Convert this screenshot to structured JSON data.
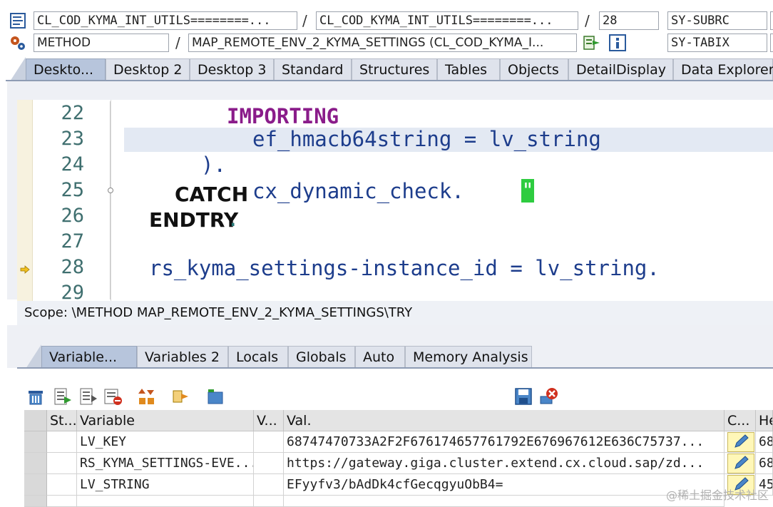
{
  "header": {
    "program": "CL_COD_KYMA_INT_UTILS========...",
    "include": "CL_COD_KYMA_INT_UTILS========...",
    "line": "28",
    "type": "METHOD",
    "method": "MAP_REMOTE_ENV_2_KYMA_SETTINGS (CL_COD_KYMA_I...",
    "sys_field_1": "SY-SUBRC",
    "sys_field_2": "SY-TABIX",
    "separator": "/"
  },
  "top_tabs": [
    "Deskto...",
    "Desktop 2",
    "Desktop 3",
    "Standard",
    "Structures",
    "Tables",
    "Objects",
    "DetailDisplay",
    "Data Explorer"
  ],
  "editor": {
    "lines": [
      {
        "num": "22",
        "kw": "IMPORTING"
      },
      {
        "num": "23",
        "text": "ef_hmacb64string = lv_string"
      },
      {
        "num": "24",
        "text": ")."
      },
      {
        "num": "25",
        "kw": "CATCH",
        "text": "cx_dynamic_check.",
        "comment": "\""
      },
      {
        "num": "26",
        "kw": "ENDTRY",
        "text": "."
      },
      {
        "num": "27"
      },
      {
        "num": "28",
        "text": "rs_kyma_settings-instance_id = lv_string."
      },
      {
        "num": "29"
      }
    ]
  },
  "scope": "Scope: \\METHOD MAP_REMOTE_ENV_2_KYMA_SETTINGS\\TRY",
  "bottom_tabs": [
    "Variable...",
    "Variables 2",
    "Locals",
    "Globals",
    "Auto",
    "Memory Analysis"
  ],
  "grid": {
    "headers": [
      "St...",
      "Variable",
      "V...",
      "Val.",
      "C...",
      "He"
    ],
    "rows": [
      {
        "variable": "LV_KEY",
        "value": "68747470733A2F2F676174657761792E676967612E636C75737...",
        "hex": "68"
      },
      {
        "variable": "RS_KYMA_SETTINGS-EVE...",
        "value": "https://gateway.giga.cluster.extend.cx.cloud.sap/zd...",
        "hex": "68"
      },
      {
        "variable": "LV_STRING",
        "value": "EFyyfv3/bAdDk4cfGecqgyuObB4=",
        "hex": "45"
      }
    ]
  },
  "watermark": "@稀土掘金技术社区",
  "colors": {
    "keyword": "#8a1c8a",
    "identifier": "#1d3d8c",
    "line_number": "#3f6f6f",
    "active_tab": "#b7c5dc",
    "comment_marker": "#2ecc40"
  }
}
